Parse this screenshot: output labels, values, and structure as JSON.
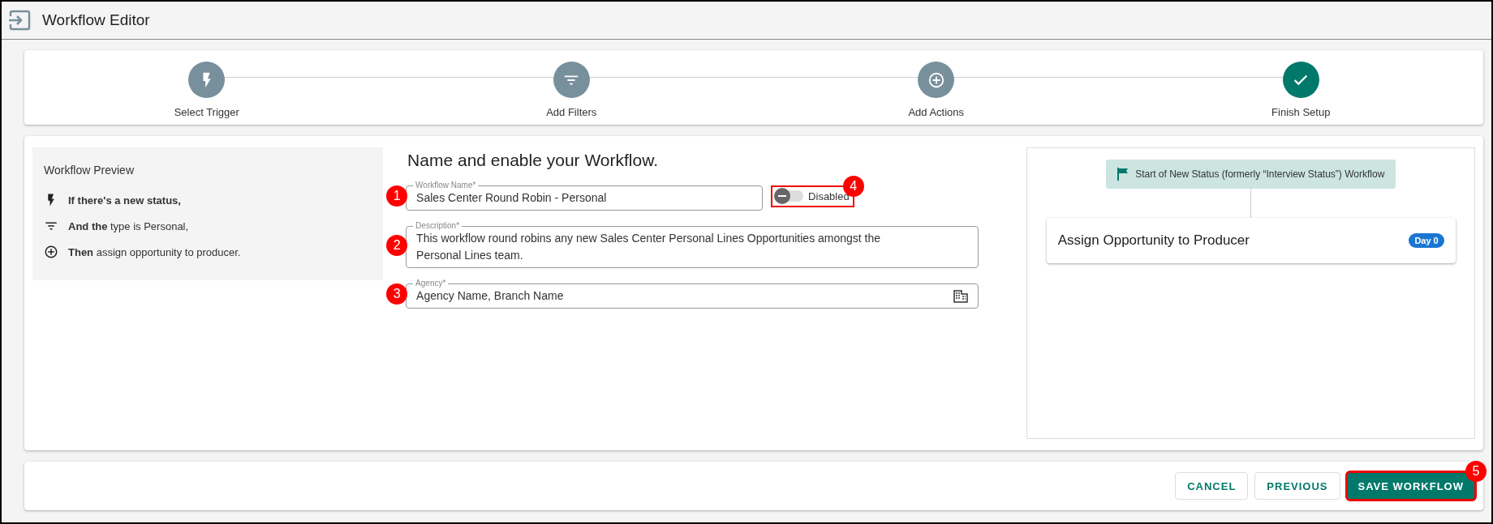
{
  "window": {
    "title": "Workflow Editor"
  },
  "steps": [
    {
      "label": "Select Trigger",
      "kind": "trigger",
      "selected": false
    },
    {
      "label": "Add Filters",
      "kind": "filter",
      "selected": false
    },
    {
      "label": "Add Actions",
      "kind": "action",
      "selected": false
    },
    {
      "label": "Finish Setup",
      "kind": "finish",
      "selected": true
    }
  ],
  "preview": {
    "title": "Workflow Preview",
    "lines": [
      {
        "kind": "trigger",
        "text": "**If there's a new status,**"
      },
      {
        "kind": "filter",
        "text": "**And the** type is Personal,"
      },
      {
        "kind": "action",
        "text": "**Then** assign opportunity to producer."
      }
    ]
  },
  "form": {
    "title": "Name and enable your Workflow.",
    "name": {
      "label": "Workflow Name*",
      "value": "Sales Center Round Robin - Personal",
      "marker": "1"
    },
    "toggle": {
      "label": "Disabled",
      "on": false,
      "marker": "4"
    },
    "description": {
      "label": "Description*",
      "value": "This workflow round robins any new Sales Center Personal Lines Opportunities amongst the Personal Lines team.",
      "marker": "2"
    },
    "agency": {
      "label": "Agency*",
      "value": "Agency Name, Branch Name",
      "marker": "3"
    }
  },
  "diagram": {
    "start": "Start of New Status (formerly “Interview Status”) Workflow",
    "action": {
      "title": "Assign Opportunity to Producer",
      "badge": "Day 0"
    }
  },
  "buttons": [
    {
      "label": "CANCEL",
      "kind": "outline"
    },
    {
      "label": "PREVIOUS",
      "kind": "outline"
    },
    {
      "label": "SAVE WORKFLOW",
      "kind": "primary",
      "marker": "5"
    }
  ]
}
